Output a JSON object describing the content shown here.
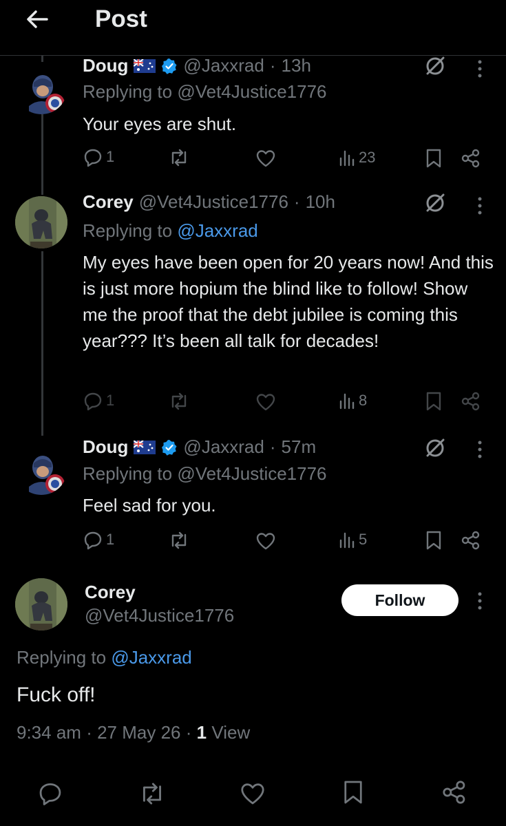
{
  "header": {
    "title": "Post"
  },
  "replies": [
    {
      "name": "Doug",
      "verified": true,
      "flag": "au-flag",
      "handle": "@Jaxxrad",
      "sep": "·",
      "time": "13h",
      "replying_prefix": "Replying to",
      "replying_to": "@Vet4Justice1776",
      "text": "Your eyes are shut.",
      "replies": "1",
      "views": "23"
    },
    {
      "name": "Corey",
      "verified": false,
      "handle": "@Vet4Justice1776",
      "sep": "·",
      "time": "10h",
      "replying_prefix": "Replying to",
      "replying_to": "@Jaxxrad",
      "text": "My eyes have been open for 20 years now! And this is just more hopium the blind like to follow! Show me the proof that the debt jubilee is coming this year??? It’s been all talk for decades!",
      "replies": "1",
      "views": "8"
    },
    {
      "name": "Doug",
      "verified": true,
      "flag": "au-flag",
      "handle": "@Jaxxrad",
      "sep": "·",
      "time": "57m",
      "replying_prefix": "Replying to",
      "replying_to": "@Vet4Justice1776",
      "text": "Feel sad for you.",
      "replies": "1",
      "views": "5"
    }
  ],
  "main_post": {
    "name": "Corey",
    "handle": "@Vet4Justice1776",
    "follow_label": "Follow",
    "replying_prefix": "Replying to",
    "replying_to": "@Jaxxrad",
    "text": "Fuck off!",
    "time": "9:34 am",
    "date": "27 May 26",
    "view_count": "1",
    "view_label": "View",
    "sep": "·"
  },
  "colors": {
    "background": "#000000",
    "text": "#e7e9ea",
    "muted": "#71767b",
    "link": "#4a99e9",
    "verified": "#1d9bf0"
  }
}
